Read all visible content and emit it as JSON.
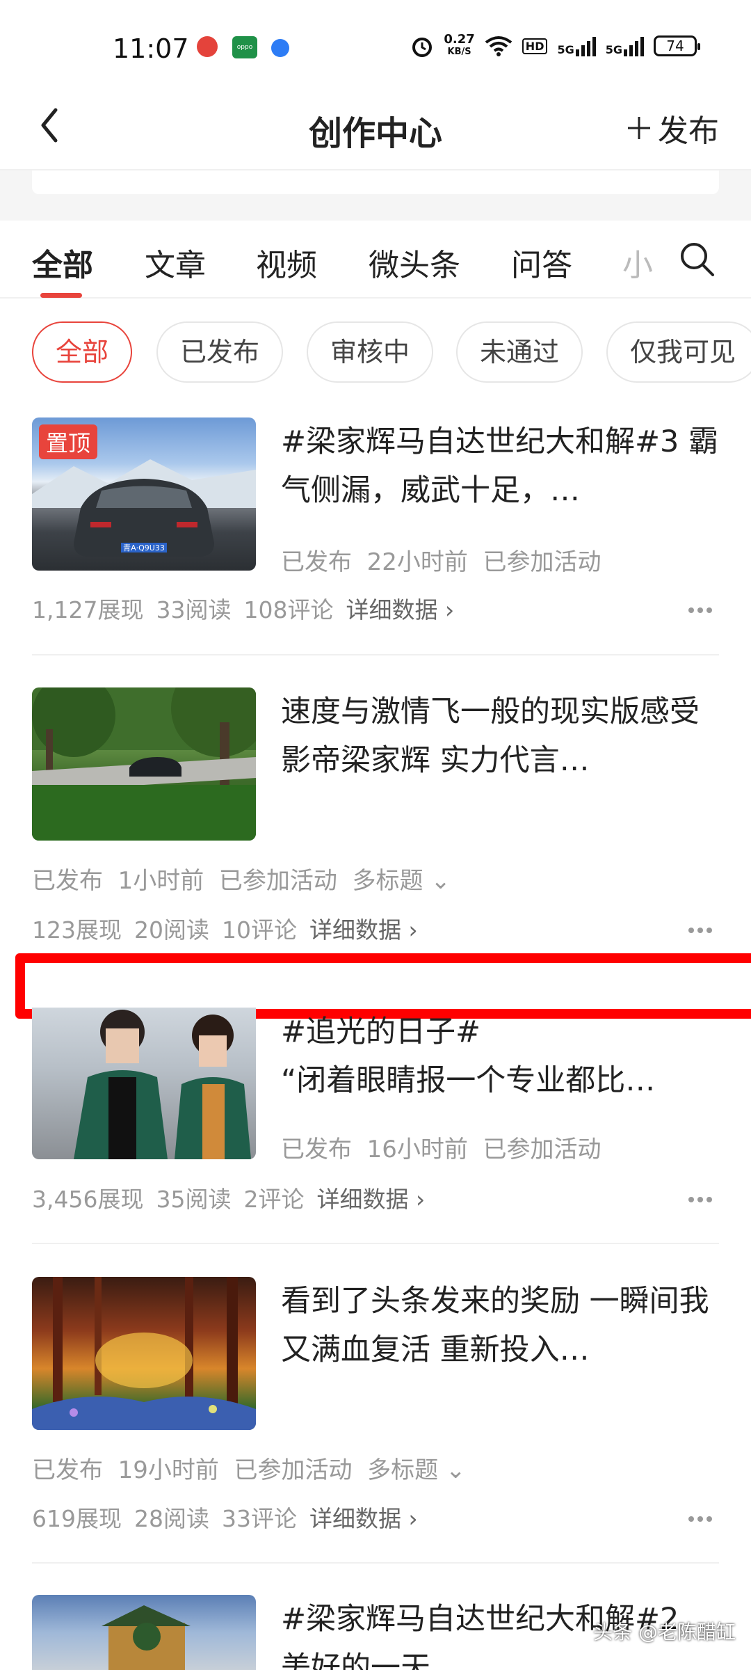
{
  "status_bar": {
    "time": "11:07",
    "net_speed_value": "0.27",
    "net_speed_unit": "KB/S",
    "hd": "HD",
    "signal1": "5G",
    "signal2": "5G",
    "battery": "74"
  },
  "header": {
    "title": "创作中心",
    "publish_label": "发布"
  },
  "tabs": [
    {
      "label": "全部",
      "active": true
    },
    {
      "label": "文章"
    },
    {
      "label": "视频"
    },
    {
      "label": "微头条"
    },
    {
      "label": "问答"
    },
    {
      "label": "小"
    }
  ],
  "filters": [
    {
      "label": "全部",
      "active": true
    },
    {
      "label": "已发布"
    },
    {
      "label": "审核中"
    },
    {
      "label": "未通过"
    },
    {
      "label": "仅我可见"
    }
  ],
  "items": [
    {
      "badge": "置顶",
      "title": "#梁家辉马自达世纪大和解#3 霸气侧漏，威武十足，…",
      "status": "已发布",
      "time": "22小时前",
      "activity": "已参加活动",
      "impressions": "1,127展现",
      "reads": "33阅读",
      "comments": "108评论",
      "detail": "详细数据 ›",
      "plate": "青A·Q9U33"
    },
    {
      "title": "速度与激情飞一般的现实版感受 影帝梁家辉 实力代言…",
      "status": "已发布",
      "time": "1小时前",
      "activity": "已参加活动",
      "multi": "多标题 ⌄",
      "impressions": "123展现",
      "reads": "20阅读",
      "comments": "10评论",
      "detail": "详细数据 ›"
    },
    {
      "title_line1": "#追光的日子#",
      "title_line2": "“闭着眼睛报一个专业都比…",
      "status": "已发布",
      "time": "16小时前",
      "activity": "已参加活动",
      "impressions": "3,456展现",
      "reads": "35阅读",
      "comments": "2评论",
      "detail": "详细数据 ›"
    },
    {
      "title": "看到了头条发来的奖励 一瞬间我又满血复活 重新投入…",
      "status": "已发布",
      "time": "19小时前",
      "activity": "已参加活动",
      "multi": "多标题 ⌄",
      "impressions": "619展现",
      "reads": "28阅读",
      "comments": "33评论",
      "detail": "详细数据 ›"
    },
    {
      "title_line1": "#梁家辉马自达世纪大和解#2",
      "title_line2": "美好的一天"
    }
  ],
  "watermark": "头条 @老陈醋缸",
  "colors": {
    "accent": "#e8443c",
    "highlight_box": "#ff0000"
  }
}
